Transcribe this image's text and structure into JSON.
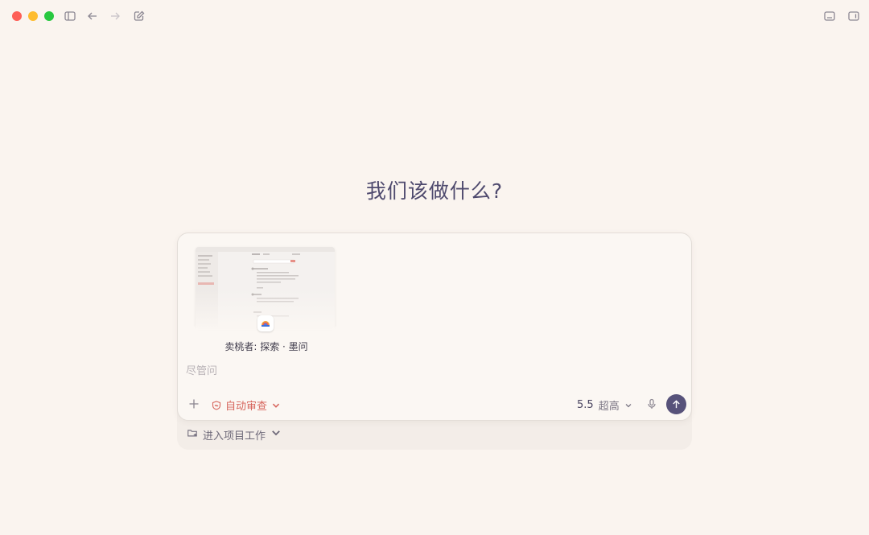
{
  "window": {
    "toolbar_icons": [
      "sidebar-toggle-icon",
      "back-arrow-icon",
      "forward-arrow-icon",
      "compose-icon"
    ],
    "right_icons": [
      "bottom-panel-icon",
      "right-panel-icon"
    ]
  },
  "main": {
    "title": "我们该做什么?"
  },
  "composer": {
    "attachment": {
      "label": "卖桃者: 探索 · 墨问",
      "icon": "app-icon"
    },
    "placeholder": "尽管问",
    "review_label": "自动审查",
    "model_version": "5.5",
    "model_level": "超高",
    "accent": "#d7665d",
    "send_color": "#57527a"
  },
  "project": {
    "label": "进入项目工作"
  }
}
